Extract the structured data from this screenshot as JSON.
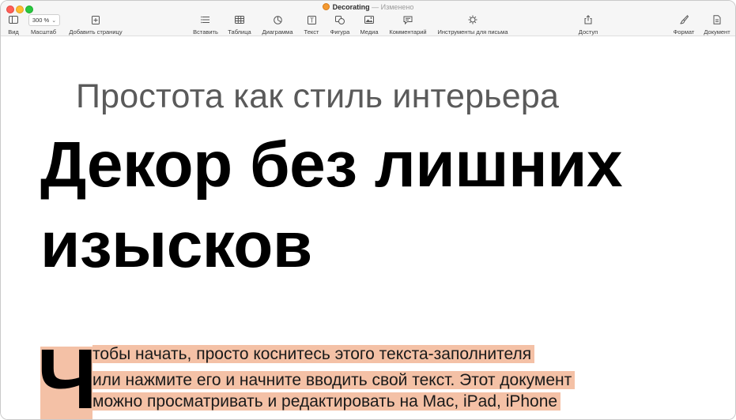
{
  "window": {
    "title": "Decorating",
    "status": "— Изменено"
  },
  "toolbar": {
    "view_label": "Вид",
    "zoom_value": "300 %",
    "zoom_label": "Масштаб",
    "add_page_label": "Добавить страницу",
    "insert_label": "Вставить",
    "table_label": "Таблица",
    "chart_label": "Диаграмма",
    "text_label": "Текст",
    "shape_label": "Фигура",
    "media_label": "Медиа",
    "comment_label": "Комментарий",
    "mail_tools_label": "Инструменты для письма",
    "share_label": "Доступ",
    "format_label": "Формат",
    "document_label": "Документ"
  },
  "document": {
    "subtitle": "Простота как стиль интерьера",
    "headline": "Декор без лишних изысков",
    "drop_cap": "Ч",
    "body_lines": [
      "тобы начать, просто коснитесь этого текста-заполнителя",
      "или нажмите его и начните вводить свой текст. Этот документ",
      "можно просматривать и редактировать на Mac, iPad, iPhone"
    ],
    "highlight_color": "#f4c1a6"
  }
}
